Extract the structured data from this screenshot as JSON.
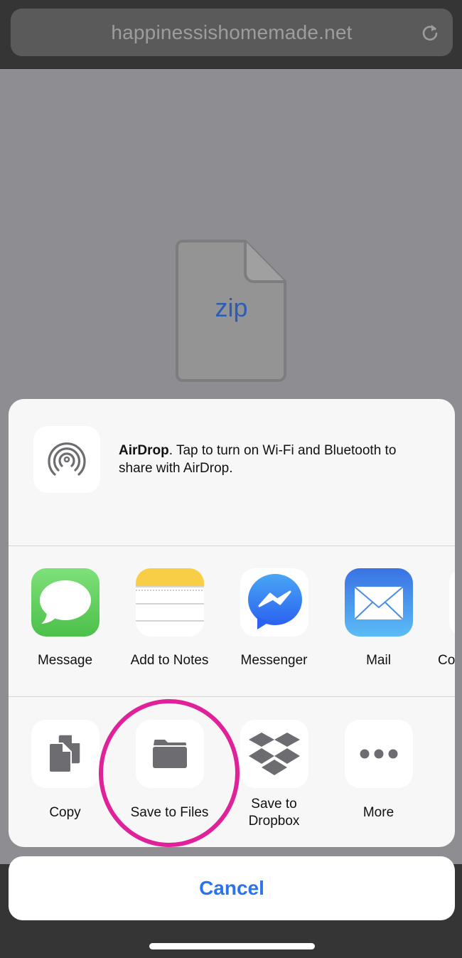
{
  "browser": {
    "url": "happinessishomemade.net",
    "reload_icon": "reload-icon"
  },
  "preview": {
    "file_extension": "zip",
    "file_icon": "document-icon"
  },
  "share_sheet": {
    "airdrop": {
      "title": "AirDrop",
      "message": ". Tap to turn on Wi-Fi and Bluetooth to share with AirDrop.",
      "icon": "airdrop-icon"
    },
    "apps": [
      {
        "label": "Message",
        "icon": "messages-icon"
      },
      {
        "label": "Add to Notes",
        "icon": "notes-icon"
      },
      {
        "label": "Messenger",
        "icon": "messenger-icon"
      },
      {
        "label": "Mail",
        "icon": "mail-icon"
      },
      {
        "label": "Co",
        "icon": "partial-app-icon"
      }
    ],
    "actions": [
      {
        "label": "Copy",
        "icon": "copy-icon"
      },
      {
        "label": "Save to Files",
        "icon": "folder-icon"
      },
      {
        "label_line1": "Save to",
        "label_line2": "Dropbox",
        "icon": "dropbox-icon"
      },
      {
        "label": "More",
        "icon": "more-icon"
      }
    ],
    "highlighted_action": "Save to Files"
  },
  "cancel_button": {
    "label": "Cancel"
  },
  "colors": {
    "accent_blue": "#2a74f0",
    "highlight_pink": "#e0229a",
    "messages_green": "#4cc04a",
    "notes_yellow": "#f7ce46"
  }
}
